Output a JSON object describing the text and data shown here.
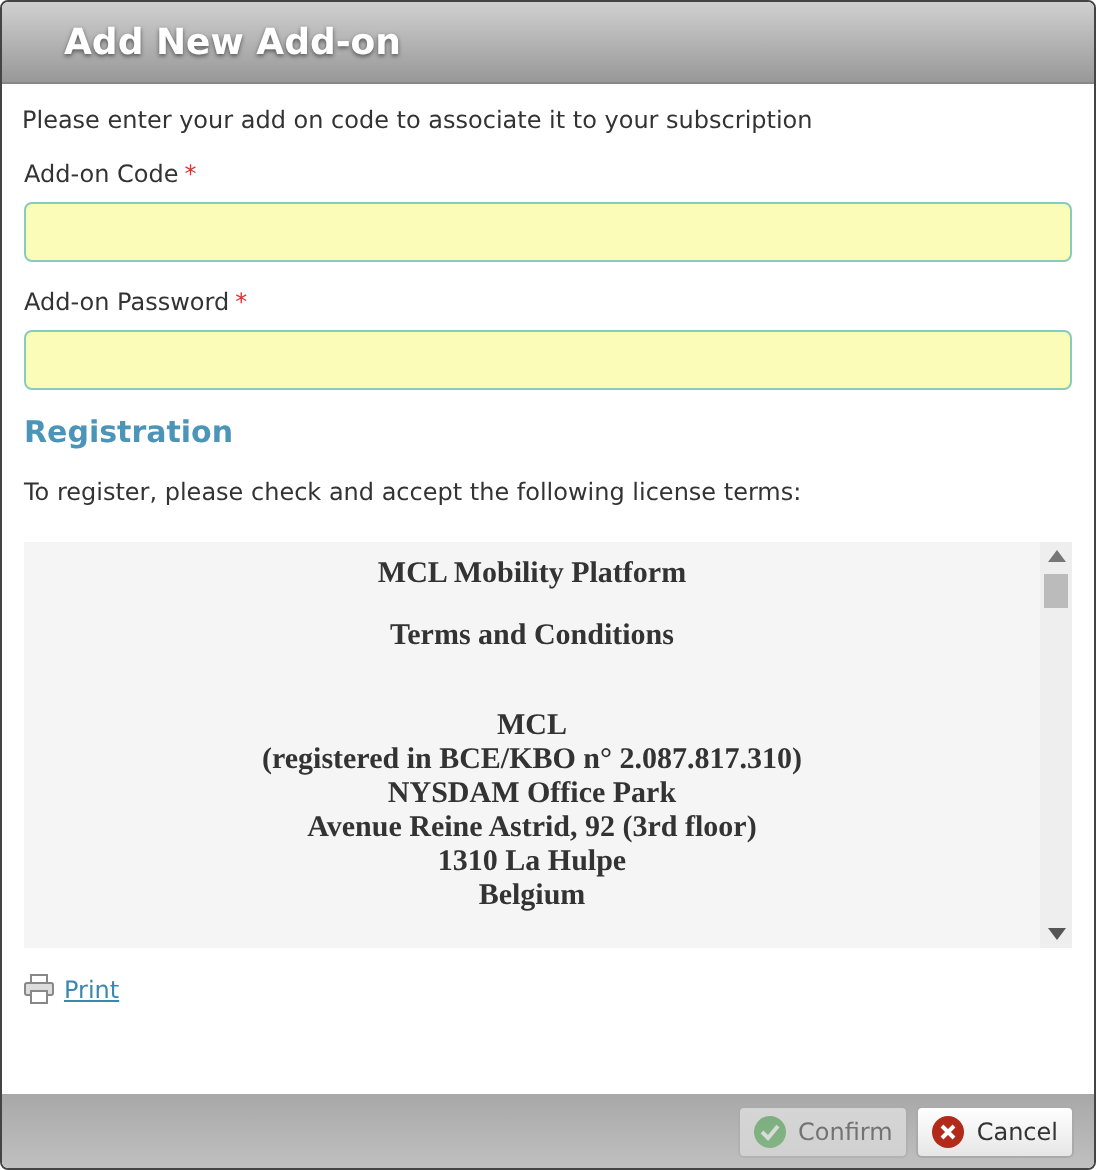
{
  "window": {
    "title": "Add New Add-on"
  },
  "intro": "Please enter your add on code to associate it to your subscription",
  "fields": [
    {
      "label": "Add-on Code",
      "required_mark": "*"
    },
    {
      "label": "Add-on Password",
      "required_mark": "*"
    }
  ],
  "registration": {
    "heading": "Registration",
    "instructions": "To register, please check and accept the following license terms:",
    "terms": {
      "title": "MCL Mobility Platform",
      "subtitle": "Terms and Conditions",
      "address": [
        "MCL",
        "(registered in BCE/KBO n° 2.087.817.310)",
        "NYSDAM Office Park",
        "Avenue Reine Astrid, 92 (3rd floor)",
        "1310 La Hulpe",
        "Belgium"
      ]
    },
    "print_link": "Print"
  },
  "buttons": [
    {
      "label": "Confirm",
      "kind": "confirm",
      "disabled": true
    },
    {
      "label": "Cancel",
      "kind": "cancel",
      "disabled": false
    }
  ]
}
